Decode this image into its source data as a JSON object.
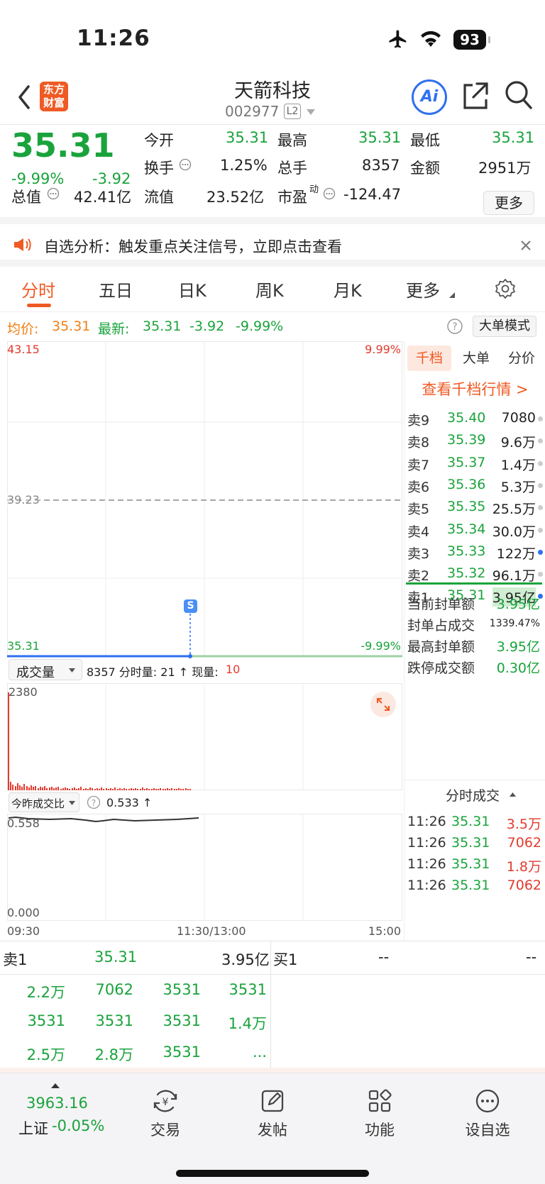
{
  "status_bar": {
    "time": "11:26",
    "battery": "93"
  },
  "header": {
    "logo_line1": "东方",
    "logo_line2": "财富",
    "title": "天箭科技",
    "code": "002977",
    "level_badge": "L2",
    "ai_label": "Ai"
  },
  "quote": {
    "price": "35.31",
    "change_pct": "-9.99%",
    "change": "-3.92",
    "open_label": "今开",
    "open": "35.31",
    "high_label": "最高",
    "high": "35.31",
    "low_label": "最低",
    "low": "35.31",
    "turnover_label": "换手",
    "turnover": "1.25%",
    "volume_label": "总手",
    "volume": "8357",
    "amount_label": "金额",
    "amount": "2951万",
    "mktcap_label": "总值",
    "mktcap": "42.41亿",
    "float_label": "流值",
    "float_cap": "23.52亿",
    "pe_label": "市盈",
    "pe_sup": "动",
    "pe": "-124.47",
    "more_button": "更多"
  },
  "banner": {
    "text": "自选分析：触发重点关注信号，立即点击查看"
  },
  "tabs": [
    "分时",
    "五日",
    "日K",
    "周K",
    "月K",
    "更多"
  ],
  "info_line": {
    "avg_label": "均价:",
    "avg": "35.31",
    "latest_label": "最新:",
    "latest": "35.31",
    "latest_change": "-3.92",
    "latest_pct": "-9.99%",
    "big_order_button": "大单模式"
  },
  "chart": {
    "price_top": "43.15",
    "pct_top": "9.99%",
    "price_mid": "39.23",
    "price_bottom": "35.31",
    "pct_bottom": "-9.99%",
    "marker": "S",
    "volume_dropdown": "成交量",
    "volume_info": "8357 分时量: 21 ↑ 现量:",
    "volume_now": "10",
    "volume_max": "2380",
    "ratio_dropdown": "今昨成交比",
    "ratio_value": "0.533 ↑",
    "ratio_top": "0.558",
    "ratio_bottom": "0.000",
    "time_start": "09:30",
    "time_mid": "11:30/13:00",
    "time_end": "15:00"
  },
  "order_book": {
    "tabs": [
      "千档",
      "大单",
      "分价"
    ],
    "link": "查看千档行情 >",
    "asks": [
      {
        "label": "卖9",
        "price": "35.40",
        "vol": "7080"
      },
      {
        "label": "卖8",
        "price": "35.39",
        "vol": "9.6万"
      },
      {
        "label": "卖7",
        "price": "35.37",
        "vol": "1.4万"
      },
      {
        "label": "卖6",
        "price": "35.36",
        "vol": "5.3万"
      },
      {
        "label": "卖5",
        "price": "35.35",
        "vol": "25.5万"
      },
      {
        "label": "卖4",
        "price": "35.34",
        "vol": "30.0万"
      },
      {
        "label": "卖3",
        "price": "35.33",
        "vol": "122万"
      },
      {
        "label": "卖2",
        "price": "35.32",
        "vol": "96.1万"
      },
      {
        "label": "卖1",
        "price": "35.31",
        "vol": "3.95亿"
      }
    ],
    "seal_stats": [
      {
        "label": "当前封单额",
        "value": "3.95亿"
      },
      {
        "label": "封单占成交",
        "value": "1339.47%"
      },
      {
        "label": "最高封单额",
        "value": "3.95亿"
      },
      {
        "label": "跌停成交额",
        "value": "0.30亿"
      }
    ],
    "ticks_title": "分时成交",
    "ticks": [
      {
        "time": "11:26",
        "price": "35.31",
        "vol": "3.5万"
      },
      {
        "time": "11:26",
        "price": "35.31",
        "vol": "7062"
      },
      {
        "time": "11:26",
        "price": "35.31",
        "vol": "1.8万"
      },
      {
        "time": "11:26",
        "price": "35.31",
        "vol": "7062"
      }
    ]
  },
  "bottom_grid": {
    "sell1_label": "卖1",
    "sell1_price": "35.31",
    "sell1_amount": "3.95亿",
    "buy1_label": "买1",
    "buy1_price": "--",
    "buy1_amount": "--",
    "queue": [
      "2.2万",
      "7062",
      "3531",
      "3531",
      "3531",
      "3531",
      "3531",
      "1.4万",
      "2.5万",
      "2.8万",
      "3531",
      "..."
    ]
  },
  "bottom_nav": {
    "index_value": "3963.16",
    "index_name": "上证",
    "index_change": "-0.05%",
    "items": [
      "交易",
      "发帖",
      "功能",
      "设自选"
    ]
  }
}
